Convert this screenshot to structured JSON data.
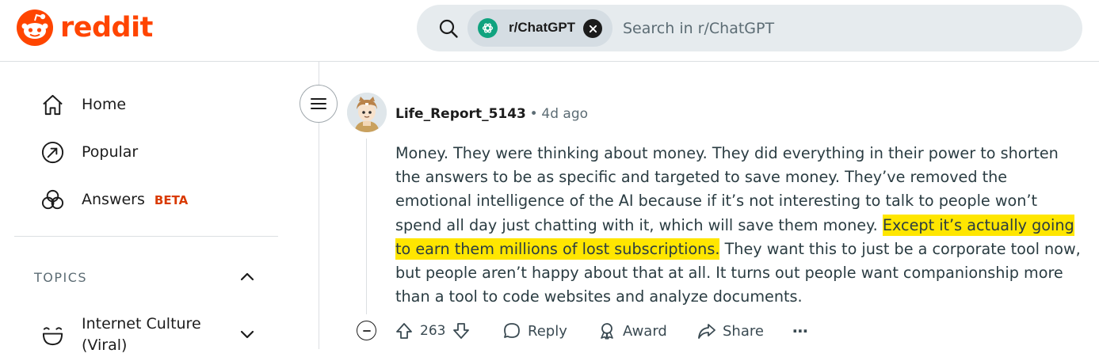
{
  "header": {
    "logo_text": "reddit",
    "search": {
      "community": "r/ChatGPT",
      "placeholder": "Search in r/ChatGPT"
    }
  },
  "sidebar": {
    "items": [
      {
        "label": "Home",
        "icon": "home-icon"
      },
      {
        "label": "Popular",
        "icon": "popular-icon"
      },
      {
        "label": "Answers",
        "icon": "answers-icon",
        "badge": "BETA"
      }
    ],
    "topics_heading": "TOPICS",
    "topics": [
      {
        "label": "Internet Culture (Viral)",
        "icon": "internet-culture-icon"
      }
    ]
  },
  "comment": {
    "author": "Life_Report_5143",
    "separator": "•",
    "time": "4d ago",
    "body_before": "Money. They were thinking about money. They did everything in their power to shorten the answers to be as specific and targeted to save money. They’ve removed the emotional intelligence of the AI because if it’s not interesting to talk to people won’t spend all day just chatting with it, which will save them money.",
    "body_highlight": "Except it’s actually going to earn them millions of lost subscriptions.",
    "body_after": "They want this to just be a corporate tool now, but people aren’t happy about that at all. It turns out people want companionship more than a tool to code websites and analyze documents.",
    "score": "263",
    "actions": {
      "reply": "Reply",
      "award": "Award",
      "share": "Share",
      "more": "⋯"
    }
  },
  "colors": {
    "brand": "#ff4500",
    "highlight": "#ffe600",
    "chatgpt": "#10a37f"
  }
}
